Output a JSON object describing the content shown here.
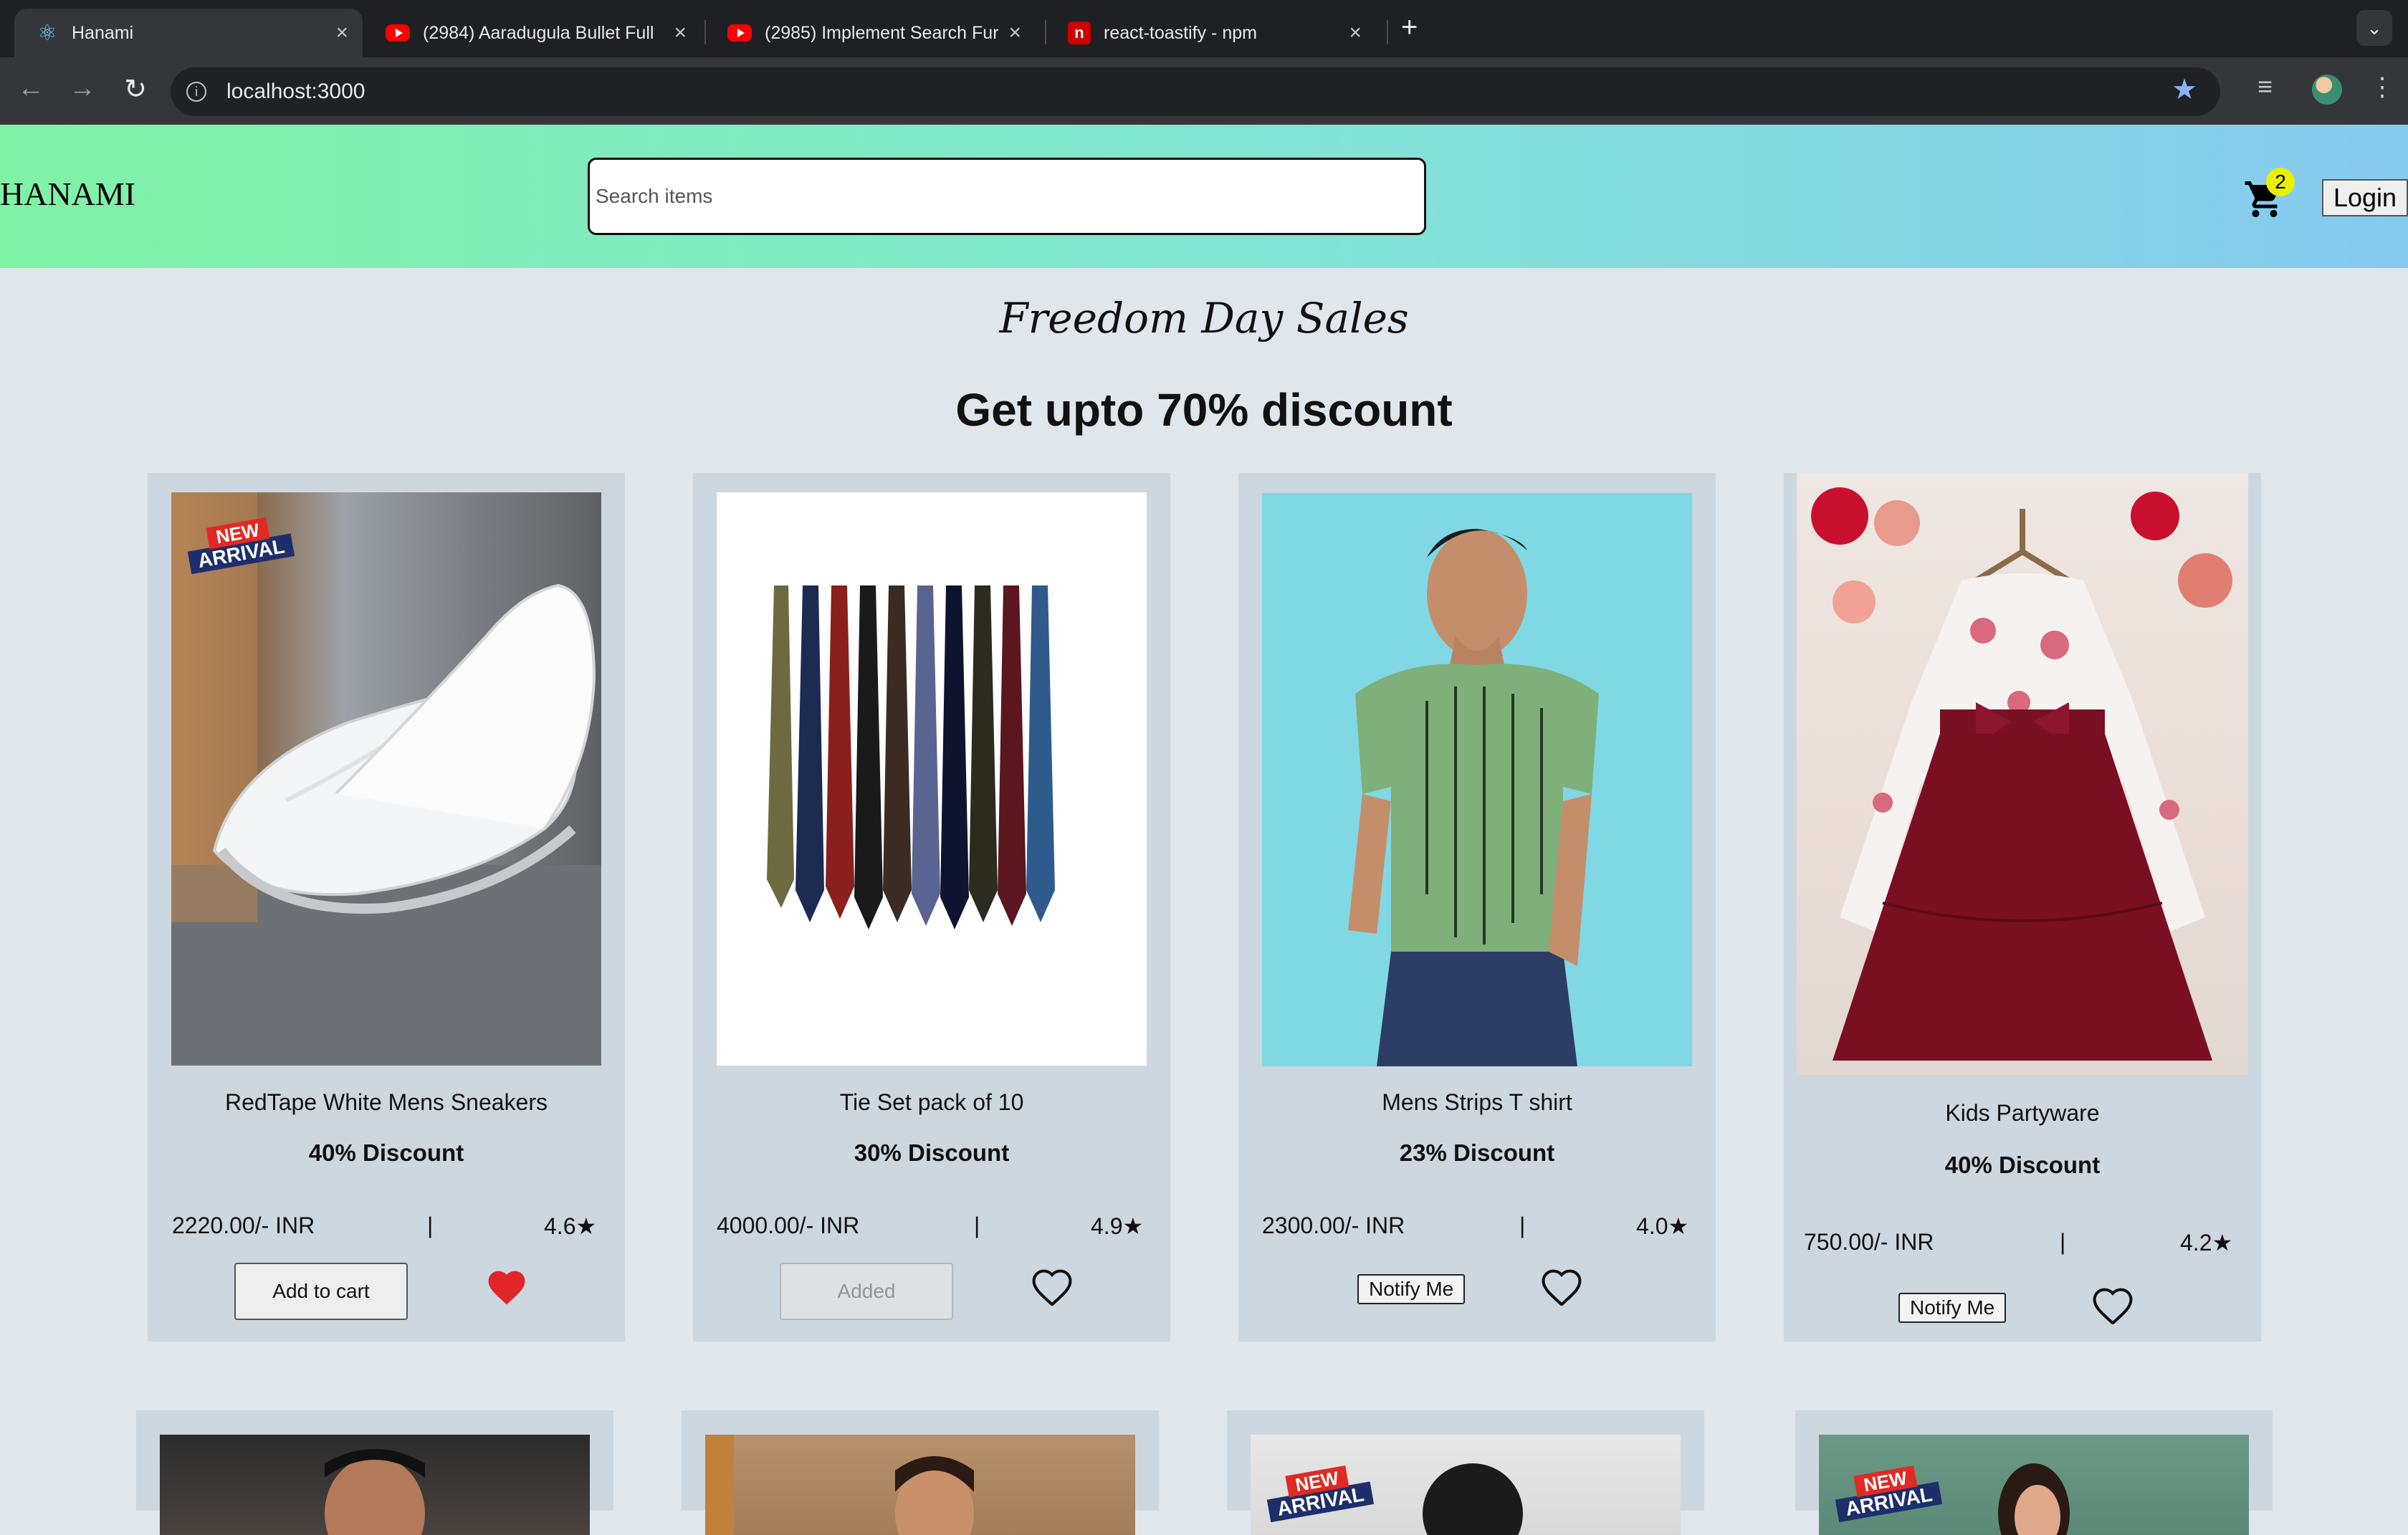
{
  "browser": {
    "tabs": [
      {
        "title": "Hanami",
        "favicon": "react-icon",
        "active": true
      },
      {
        "title": "(2984) Aaradugula Bullet Full",
        "favicon": "youtube-icon",
        "active": false
      },
      {
        "title": "(2985) Implement Search Fur",
        "favicon": "youtube-icon",
        "active": false
      },
      {
        "title": "react-toastify - npm",
        "favicon": "npm-icon",
        "active": false
      }
    ],
    "close_glyph": "×",
    "new_tab_glyph": "+",
    "url": "localhost:3000"
  },
  "header": {
    "brand": "HANAMI",
    "search_placeholder": "Search items",
    "cart_count": "2",
    "login_label": "Login"
  },
  "promo": {
    "subtitle": "Freedom Day Sales",
    "title": "Get upto 70% discount"
  },
  "products": [
    {
      "name": "RedTape White Mens Sneakers",
      "discount": "40% Discount",
      "price": "2220.00/- INR",
      "separator": "|",
      "rating": "4.6★",
      "action": "Add to cart",
      "action_type": "add",
      "wishlisted": true,
      "new_arrival": true
    },
    {
      "name": "Tie Set pack of 10",
      "discount": "30% Discount",
      "price": "4000.00/- INR",
      "separator": "|",
      "rating": "4.9★",
      "action": "Added",
      "action_type": "added",
      "wishlisted": false,
      "new_arrival": false
    },
    {
      "name": "Mens Strips T shirt",
      "discount": "23% Discount",
      "price": "2300.00/- INR",
      "separator": "|",
      "rating": "4.0★",
      "action": "Notify Me",
      "action_type": "notify",
      "wishlisted": false,
      "new_arrival": false
    },
    {
      "name": "Kids Partyware",
      "discount": "40% Discount",
      "price": "750.00/- INR",
      "separator": "|",
      "rating": "4.2★",
      "action": "Notify Me",
      "action_type": "notify",
      "wishlisted": false,
      "new_arrival": false
    }
  ],
  "badge": {
    "line1": "NEW",
    "line2": "ARRIVAL"
  },
  "colors": {
    "header_gradient_start": "#7ff2a6",
    "header_gradient_end": "#86caf0",
    "page_background": "#dfe6ec",
    "card_background": "#cdd7df",
    "heart_filled": "#e0262b",
    "cart_badge": "#e8f000"
  }
}
